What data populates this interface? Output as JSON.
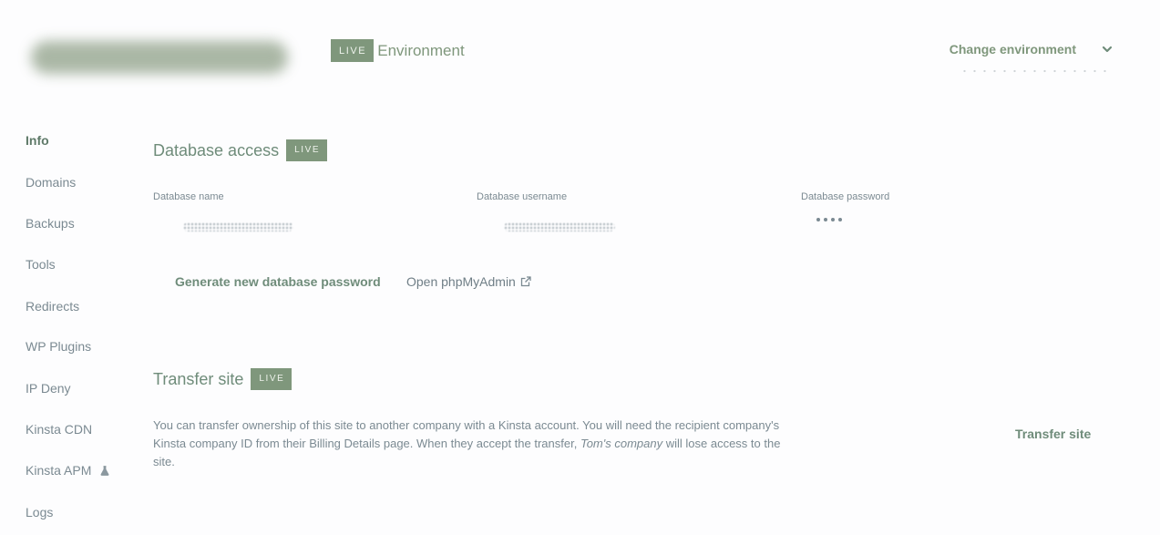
{
  "header": {
    "live_badge": "LIVE",
    "environment_label": "Environment",
    "change_environment": "Change environment"
  },
  "sidebar": {
    "items": [
      {
        "label": "Info",
        "active": true
      },
      {
        "label": "Domains"
      },
      {
        "label": "Backups"
      },
      {
        "label": "Tools"
      },
      {
        "label": "Redirects"
      },
      {
        "label": "WP Plugins"
      },
      {
        "label": "IP Deny"
      },
      {
        "label": "Kinsta CDN"
      },
      {
        "label": "Kinsta APM",
        "badge_icon": "flask-icon"
      },
      {
        "label": "Logs"
      }
    ]
  },
  "database_access": {
    "title": "Database access",
    "badge": "LIVE",
    "name_label": "Database name",
    "username_label": "Database username",
    "password_label": "Database password",
    "generate_password": "Generate new database password",
    "open_phpmyadmin": "Open phpMyAdmin"
  },
  "transfer_site": {
    "title": "Transfer site",
    "badge": "LIVE",
    "description_part1": "You can transfer ownership of this site to another company with a Kinsta account. You will need the recipient company's Kinsta company ID from their Billing Details page. When they accept the transfer, ",
    "description_company": "Tom's company",
    "description_part2": " will lose access to the site.",
    "button": "Transfer site"
  },
  "colors": {
    "accent": "#7f977c",
    "text": "#7b8a92",
    "background": "#fdfdfe"
  }
}
